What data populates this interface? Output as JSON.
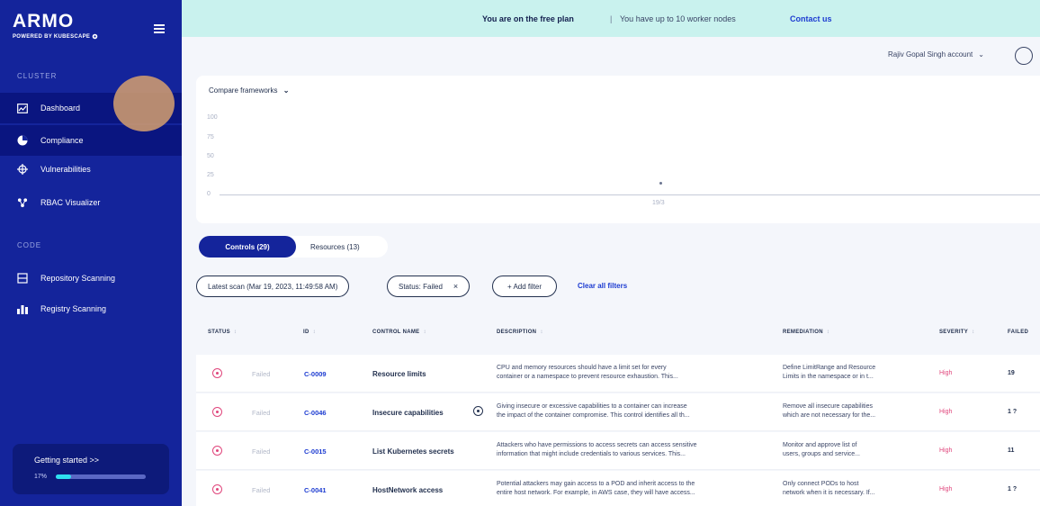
{
  "sidebar": {
    "logo": "ARMO",
    "logo_sub": "POWERED BY KUBESCAPE",
    "section_cluster": "CLUSTER",
    "section_code": "CODE",
    "items": [
      {
        "label": "Dashboard",
        "icon": "dashboard-icon"
      },
      {
        "label": "Compliance",
        "icon": "compliance-icon"
      },
      {
        "label": "Vulnerabilities",
        "icon": "vulnerabilities-icon"
      },
      {
        "label": "RBAC Visualizer",
        "icon": "rbac-icon"
      },
      {
        "label": "Repository Scanning",
        "icon": "repository-icon"
      },
      {
        "label": "Registry Scanning",
        "icon": "registry-icon"
      }
    ],
    "getting_started": {
      "label": "Getting started  >>",
      "percent": "17%",
      "progress": 0.17
    }
  },
  "banner": {
    "plan": "You are on the free plan",
    "separator": "|",
    "nodes": "You have up to 10 worker nodes",
    "contact": "Contact us"
  },
  "account": {
    "name": "Rajiv Gopal Singh account",
    "chevron": "⌄"
  },
  "chart": {
    "dropdown": "Compare frameworks",
    "chevron": "⌄",
    "yticks": [
      "100",
      "75",
      "50",
      "25",
      "0"
    ],
    "xtick": "19/3"
  },
  "chart_data": {
    "type": "line",
    "x": [
      "19/3"
    ],
    "series": [
      {
        "values": [
          14
        ]
      }
    ],
    "ylim": [
      0,
      100
    ],
    "yticks": [
      0,
      25,
      50,
      75,
      100
    ]
  },
  "tabs": {
    "controls": "Controls (29)",
    "resources": "Resources (13)"
  },
  "filters": {
    "scan": "Latest scan (Mar 19, 2023, 11:49:58 AM)",
    "status": "Status: Failed",
    "status_close": "×",
    "add": "+ Add filter",
    "clear": "Clear all filters"
  },
  "table": {
    "headers": {
      "status": "STATUS",
      "id": "ID",
      "control": "CONTROL NAME",
      "description": "DESCRIPTION",
      "remediation": "REMEDIATION",
      "severity": "SEVERITY",
      "failed": "FAILED"
    },
    "sort_glyph": "↕",
    "rows": [
      {
        "status": "Failed",
        "id": "C-0009",
        "name": "Resource limits",
        "desc1": "CPU and memory resources should have a limit set for every",
        "desc2": "container or a namespace to prevent resource exhaustion. This...",
        "rem1": "Define LimitRange and Resource",
        "rem2": "Limits in the namespace or in t...",
        "severity": "High",
        "failed": "19"
      },
      {
        "status": "Failed",
        "id": "C-0046",
        "name": "Insecure capabilities",
        "desc1": "Giving insecure or excessive capabilities to a container can increase",
        "desc2": "the impact of the container compromise. This control identifies all th...",
        "rem1": "Remove all insecure capabilities",
        "rem2": "which are not necessary for the...",
        "severity": "High",
        "failed": "1 ?"
      },
      {
        "status": "Failed",
        "id": "C-0015",
        "name": "List Kubernetes secrets",
        "desc1": "Attackers who have permissions to access secrets can access sensitive",
        "desc2": "information that might include credentials to various services. This...",
        "rem1": "Monitor and approve list of",
        "rem2": "users, groups and service...",
        "severity": "High",
        "failed": "11"
      },
      {
        "status": "Failed",
        "id": "C-0041",
        "name": "HostNetwork access",
        "desc1": "Potential attackers may gain access to a POD and inherit access to the",
        "desc2": "entire host network. For example, in AWS case, they will have access...",
        "rem1": "Only connect PODs to host",
        "rem2": "network when it is necessary. If...",
        "severity": "High",
        "failed": "1 ?"
      }
    ]
  }
}
